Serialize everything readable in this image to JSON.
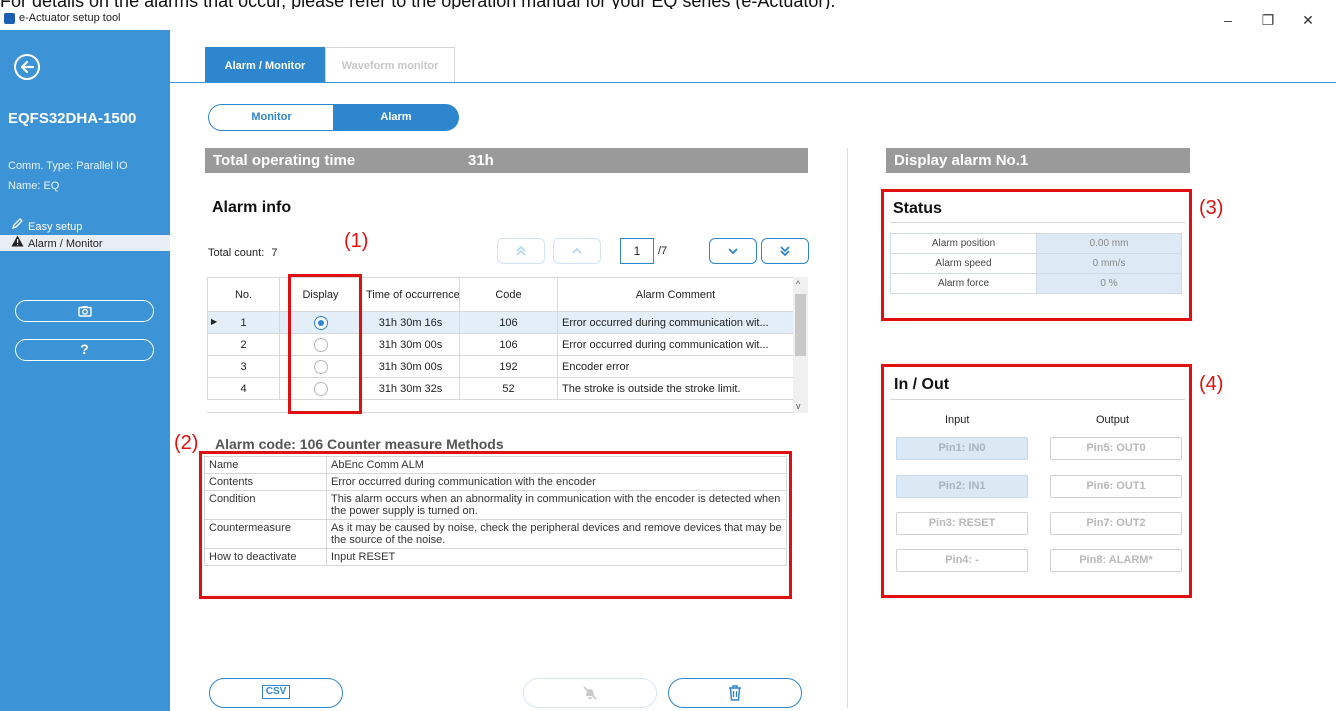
{
  "caption": "For details on the alarms that occur, please refer to the operation manual for your EQ series (e-Actuator).",
  "window": {
    "title": "e-Actuator setup tool",
    "minimize": "–",
    "restore": "❐",
    "close": "✕"
  },
  "sidebar": {
    "device": "EQFS32DHA-1500",
    "comm_type": "Comm. Type: Parallel IO",
    "name": "Name: EQ",
    "nav": [
      {
        "label": "Easy setup",
        "icon": "pencil-icon"
      },
      {
        "label": "Alarm / Monitor",
        "icon": "warning-icon"
      }
    ],
    "help_label": "?"
  },
  "tabs": [
    {
      "label": "Alarm / Monitor"
    },
    {
      "label": "Waveform monitor"
    }
  ],
  "segment": {
    "monitor": "Monitor",
    "alarm": "Alarm"
  },
  "operating": {
    "label": "Total operating time",
    "value": "31h"
  },
  "alarm_info": {
    "title": "Alarm info",
    "total_count_label": "Total count:",
    "total_count": "7",
    "page": "1",
    "pages": "/7",
    "columns": [
      "No.",
      "Display",
      "Time of occurrence",
      "Code",
      "Alarm Comment"
    ],
    "rows": [
      {
        "no": "1",
        "time": "31h 30m 16s",
        "code": "106",
        "comment": "Error occurred during communication wit...",
        "display": true
      },
      {
        "no": "2",
        "time": "31h 30m 00s",
        "code": "106",
        "comment": "Error occurred during communication wit...",
        "display": false
      },
      {
        "no": "3",
        "time": "31h 30m 00s",
        "code": "192",
        "comment": "Encoder error",
        "display": false
      },
      {
        "no": "4",
        "time": "31h 30m 32s",
        "code": "52",
        "comment": "The stroke is outside the stroke limit.",
        "display": false
      }
    ]
  },
  "measure": {
    "title": "Alarm code: 106 Counter measure Methods",
    "rows": [
      {
        "key": "Name",
        "value": "AbEnc Comm ALM"
      },
      {
        "key": "Contents",
        "value": "Error occurred during communication with the encoder"
      },
      {
        "key": "Condition",
        "value": "This alarm occurs when an abnormality in communication with the encoder is detected when the power supply is turned on."
      },
      {
        "key": "Countermeasure",
        "value": "As it may be caused by noise, check the peripheral devices and remove devices that may be the source of the noise."
      },
      {
        "key": "How to deactivate",
        "value": "Input RESET"
      }
    ]
  },
  "display_alarm": "Display alarm No.1",
  "status": {
    "title": "Status",
    "rows": [
      {
        "key": "Alarm position",
        "value": "0.00 mm"
      },
      {
        "key": "Alarm speed",
        "value": "0 mm/s"
      },
      {
        "key": "Alarm force",
        "value": "0 %"
      }
    ]
  },
  "inout": {
    "title": "In / Out",
    "input_label": "Input",
    "output_label": "Output",
    "inputs": [
      {
        "label": "Pin1: IN0",
        "on": true
      },
      {
        "label": "Pin2: IN1",
        "on": true
      },
      {
        "label": "Pin3: RESET",
        "on": false
      },
      {
        "label": "Pin4: -",
        "on": false
      }
    ],
    "outputs": [
      {
        "label": "Pin5: OUT0",
        "on": false
      },
      {
        "label": "Pin6: OUT1",
        "on": false
      },
      {
        "label": "Pin7: OUT2",
        "on": false
      },
      {
        "label": "Pin8: ALARM*",
        "on": false
      }
    ]
  },
  "annotations": {
    "a1": "(1)",
    "a2": "(2)",
    "a3": "(3)",
    "a4": "(4)"
  },
  "csv_label": "CSV",
  "colors": {
    "sidebar": "#3c93d6",
    "accent": "#2e86cf",
    "highlight": "#e01010",
    "header_gray": "#9a9a9a"
  }
}
